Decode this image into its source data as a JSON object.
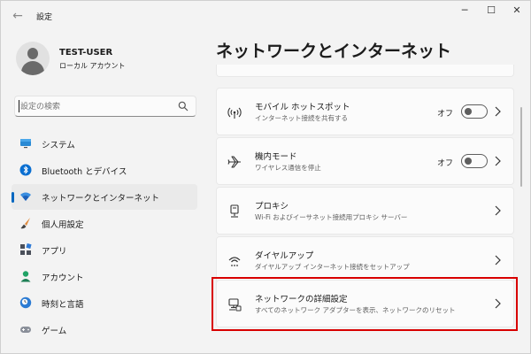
{
  "window": {
    "title": "設定",
    "back": "←",
    "min": "─",
    "max": "☐",
    "close": "✕"
  },
  "profile": {
    "name": "TEST-USER",
    "account_type": "ローカル アカウント"
  },
  "search": {
    "placeholder": "設定の検索"
  },
  "sidebar": {
    "items": [
      {
        "label": "システム",
        "icon": "monitor-icon"
      },
      {
        "label": "Bluetooth とデバイス",
        "icon": "bluetooth-icon"
      },
      {
        "label": "ネットワークとインターネット",
        "icon": "wifi-icon",
        "active": true
      },
      {
        "label": "個人用設定",
        "icon": "brush-icon"
      },
      {
        "label": "アプリ",
        "icon": "apps-icon"
      },
      {
        "label": "アカウント",
        "icon": "person-icon"
      },
      {
        "label": "時刻と言語",
        "icon": "clock-globe-icon"
      },
      {
        "label": "ゲーム",
        "icon": "gamepad-icon"
      }
    ]
  },
  "main": {
    "title": "ネットワークとインターネット",
    "cards": [
      {
        "title": "モバイル ホットスポット",
        "subtitle": "インターネット接続を共有する",
        "icon": "hotspot-icon",
        "toggle": "オフ"
      },
      {
        "title": "機内モード",
        "subtitle": "ワイヤレス通信を停止",
        "icon": "airplane-icon",
        "toggle": "オフ"
      },
      {
        "title": "プロキシ",
        "subtitle": "Wi-Fi およびイーサネット接続用プロキシ サーバー",
        "icon": "proxy-icon"
      },
      {
        "title": "ダイヤルアップ",
        "subtitle": "ダイヤルアップ インターネット接続をセットアップ",
        "icon": "dialup-icon"
      },
      {
        "title": "ネットワークの詳細設定",
        "subtitle": "すべてのネットワーク アダプターを表示、ネットワークのリセット",
        "icon": "network-computer-icon"
      }
    ]
  },
  "colors": {
    "accent": "#0067c0",
    "highlight": "#d80000",
    "window_bg": "#f3f3f3",
    "card_bg": "#fbfbfb"
  }
}
